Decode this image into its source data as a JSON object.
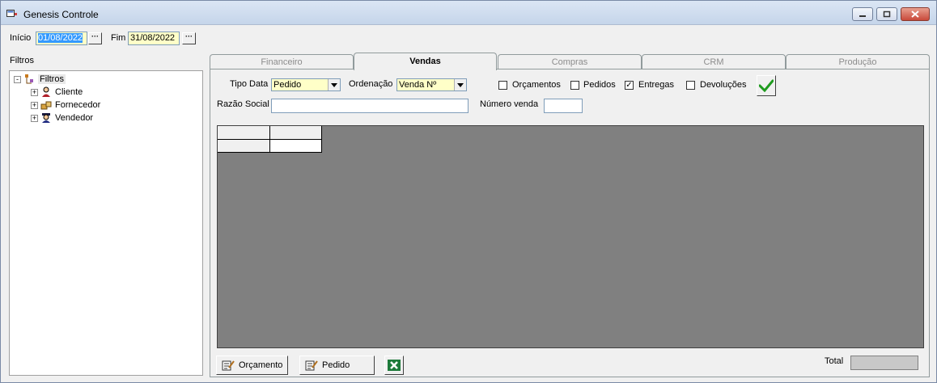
{
  "window": {
    "title": "Genesis Controle",
    "icon": "app-icon",
    "controls": [
      "minimize-icon",
      "restore-icon",
      "close-icon"
    ]
  },
  "period": {
    "start_label": "Início",
    "start_value": "01/08/2022",
    "end_label": "Fim",
    "end_value": "31/08/2022",
    "picker_glyph": "···"
  },
  "filters": {
    "section_label": "Filtros",
    "root": {
      "label": "Filtros",
      "expand": "-"
    },
    "items": [
      {
        "label": "Cliente",
        "expand": "+",
        "icon": "client-icon"
      },
      {
        "label": "Fornecedor",
        "expand": "+",
        "icon": "supplier-icon"
      },
      {
        "label": "Vendedor",
        "expand": "+",
        "icon": "seller-icon"
      }
    ]
  },
  "tabs": [
    {
      "label": "Financeiro",
      "active": false
    },
    {
      "label": "Vendas",
      "active": true
    },
    {
      "label": "Compras",
      "active": false
    },
    {
      "label": "CRM",
      "active": false
    },
    {
      "label": "Produção",
      "active": false
    }
  ],
  "vendas": {
    "tipo_data_label": "Tipo Data",
    "tipo_data_value": "Pedido",
    "ordenacao_label": "Ordenação",
    "ordenacao_value": "Venda Nº",
    "checkboxes": [
      {
        "label": "Orçamentos",
        "checked": false
      },
      {
        "label": "Pedidos",
        "checked": false
      },
      {
        "label": "Entregas",
        "checked": true
      },
      {
        "label": "Devoluções",
        "checked": false
      }
    ],
    "check_glyph": "✓",
    "razao_social_label": "Razão Social",
    "razao_social_value": "",
    "numero_venda_label": "Número venda",
    "numero_venda_value": "",
    "confirm_icon": "checkmark-icon"
  },
  "footer": {
    "orcamento_label": "Orçamento",
    "pedido_label": "Pedido",
    "excel_icon": "excel-icon",
    "total_label": "Total",
    "total_value": ""
  },
  "colors": {
    "titlebar": "#c5d5ea",
    "field_yellow": "#ffffc8",
    "grid_background": "#808080",
    "confirm_green": "#1e9b1e",
    "excel_green": "#1d7a3a"
  }
}
